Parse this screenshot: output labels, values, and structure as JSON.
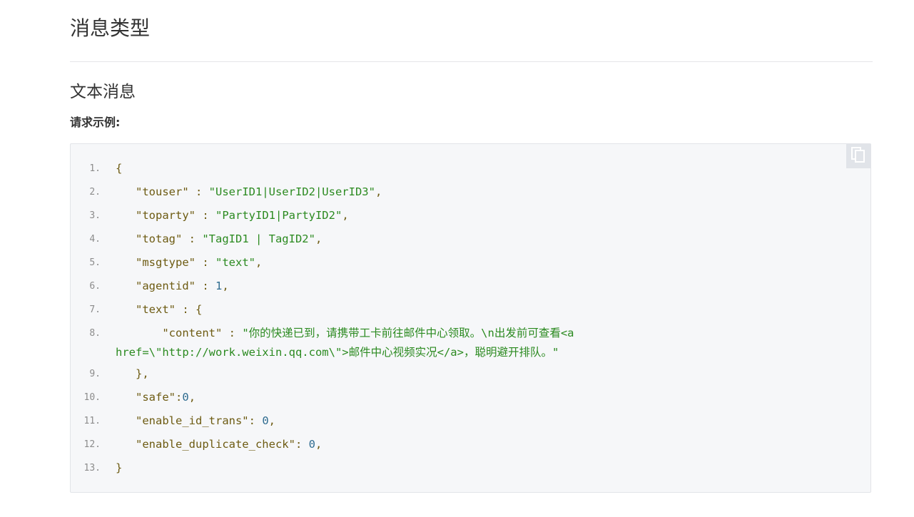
{
  "heading": "消息类型",
  "subheading": "文本消息",
  "request_label": "请求示例:",
  "copy_icon": "copy-icon",
  "code": {
    "line_numbers": [
      "1.",
      "2.",
      "3.",
      "4.",
      "5.",
      "6.",
      "7.",
      "8.",
      "9.",
      "10.",
      "11.",
      "12.",
      "13."
    ],
    "l1_brace": "{",
    "l2_key": "\"touser\"",
    "l2_sep": " : ",
    "l2_val": "\"UserID1|UserID2|UserID3\"",
    "l2_end": ",",
    "l3_key": "\"toparty\"",
    "l3_sep": " : ",
    "l3_val": "\"PartyID1|PartyID2\"",
    "l3_end": ",",
    "l4_key": "\"totag\"",
    "l4_sep": " : ",
    "l4_val": "\"TagID1 | TagID2\"",
    "l4_end": ",",
    "l5_key": "\"msgtype\"",
    "l5_sep": " : ",
    "l5_val": "\"text\"",
    "l5_end": ",",
    "l6_key": "\"agentid\"",
    "l6_sep": " : ",
    "l6_val": "1",
    "l6_end": ",",
    "l7_key": "\"text\"",
    "l7_sep": " : {",
    "l8_key": "\"content\"",
    "l8_sep": " : ",
    "l8_val": "\"你的快递已到，请携带工卡前往邮件中心领取。\\n出发前可查看<a href=\\\"http://work.weixin.qq.com\\\">邮件中心视频实况</a>，聪明避开排队。\"",
    "l9_brace": "},",
    "l10_key": "\"safe\"",
    "l10_sep": ":",
    "l10_val": "0",
    "l10_end": ",",
    "l11_key": "\"enable_id_trans\"",
    "l11_sep": ": ",
    "l11_val": "0",
    "l11_end": ",",
    "l12_key": "\"enable_duplicate_check\"",
    "l12_sep": ": ",
    "l12_val": "0",
    "l12_end": ",",
    "l13_brace": "}"
  }
}
